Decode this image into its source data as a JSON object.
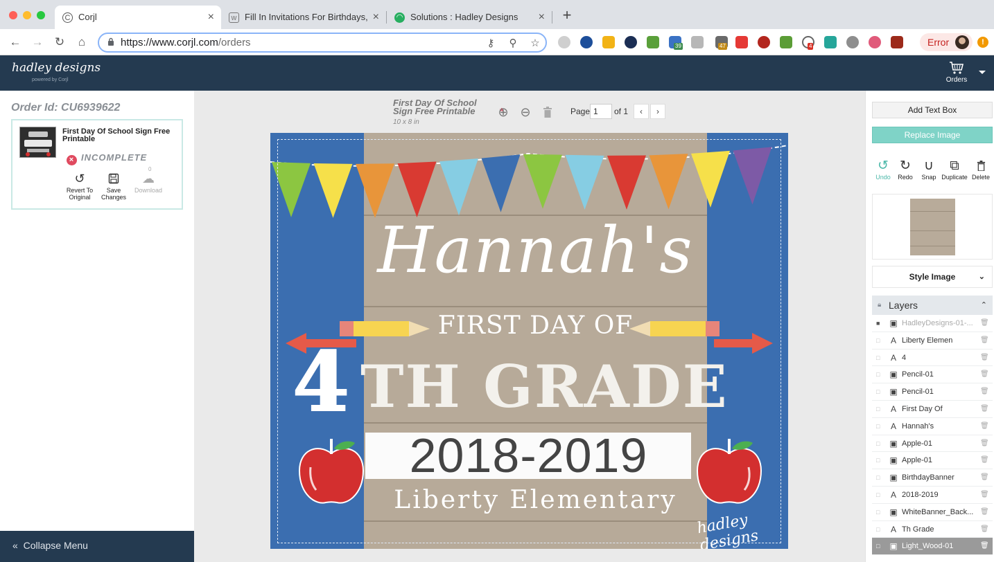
{
  "browser": {
    "tabs": [
      {
        "title": "Corjl",
        "active": true
      },
      {
        "title": "Fill In Invitations For Birthdays,",
        "active": false
      },
      {
        "title": "Solutions : Hadley Designs",
        "active": false
      }
    ],
    "new_tab": "+",
    "url_host": "https://www.corjl.com",
    "url_path": "/orders",
    "extension_badges": [
      "39",
      "47",
      "4"
    ],
    "profile_status": "Error",
    "menu_glyph": "!"
  },
  "app": {
    "logo": "hadley designs",
    "powered_by": "powered by Corjl",
    "orders_label": "Orders"
  },
  "left_panel": {
    "order_id": "Order Id: CU6939622",
    "product_title": "First Day Of School Sign Free Printable",
    "status": "INCOMPLETE",
    "actions": {
      "revert": "Revert To Original",
      "save": "Save Changes",
      "download": "Download",
      "download_count": "0"
    },
    "collapse_menu": "Collapse Menu"
  },
  "editor": {
    "doc_title": "First Day Of School Sign Free Printable",
    "unsaved_marker": "*",
    "doc_size": "10 x 8 in",
    "page_label": "Page",
    "page_current": "1",
    "page_of": "of 1",
    "prev_glyph": "‹",
    "next_glyph": "›"
  },
  "design": {
    "name_text": "Hannah's",
    "first_day_text": "FIRST DAY OF",
    "grade_number": "4",
    "grade_text": "TH GRADE",
    "year_text": "2018-2019",
    "school_text": "Liberty Elementary",
    "brand_mark": "hadley designs",
    "colors": {
      "blue_sides": "#3b6eb0",
      "wood": "#b7aa99",
      "banner": "#fbfbfb",
      "apple": "#d32f2f"
    },
    "pennant_colors": [
      "#8cc641",
      "#f6e04a",
      "#e8953a",
      "#d93a32",
      "#86cde3",
      "#3b6eb0",
      "#8cc641",
      "#86cde3",
      "#d93a32",
      "#e8953a",
      "#f6e04a",
      "#7d5aa6"
    ]
  },
  "right_panel": {
    "add_text_box": "Add Text Box",
    "replace_image": "Replace Image",
    "tools": {
      "undo": "Undo",
      "redo": "Redo",
      "snap": "Snap",
      "duplicate": "Duplicate",
      "delete": "Delete"
    },
    "style_image": "Style Image",
    "layers_title": "Layers",
    "layers": [
      {
        "name": "HadleyDesigns-01-...",
        "type": "image",
        "locked": true,
        "selected": false
      },
      {
        "name": "Liberty Elemen",
        "type": "text",
        "locked": false,
        "selected": false
      },
      {
        "name": "4",
        "type": "text",
        "locked": false,
        "selected": false
      },
      {
        "name": "Pencil-01",
        "type": "image",
        "locked": false,
        "selected": false
      },
      {
        "name": "Pencil-01",
        "type": "image",
        "locked": false,
        "selected": false
      },
      {
        "name": "First Day Of",
        "type": "text",
        "locked": false,
        "selected": false
      },
      {
        "name": "Hannah's",
        "type": "text",
        "locked": false,
        "selected": false
      },
      {
        "name": "Apple-01",
        "type": "image",
        "locked": false,
        "selected": false
      },
      {
        "name": "Apple-01",
        "type": "image",
        "locked": false,
        "selected": false
      },
      {
        "name": "BirthdayBanner",
        "type": "image",
        "locked": false,
        "selected": false
      },
      {
        "name": "2018-2019",
        "type": "text",
        "locked": false,
        "selected": false
      },
      {
        "name": "WhiteBanner_Back...",
        "type": "image",
        "locked": false,
        "selected": false
      },
      {
        "name": "Th Grade",
        "type": "text",
        "locked": false,
        "selected": false
      },
      {
        "name": "Light_Wood-01",
        "type": "image",
        "locked": false,
        "selected": true
      }
    ]
  }
}
